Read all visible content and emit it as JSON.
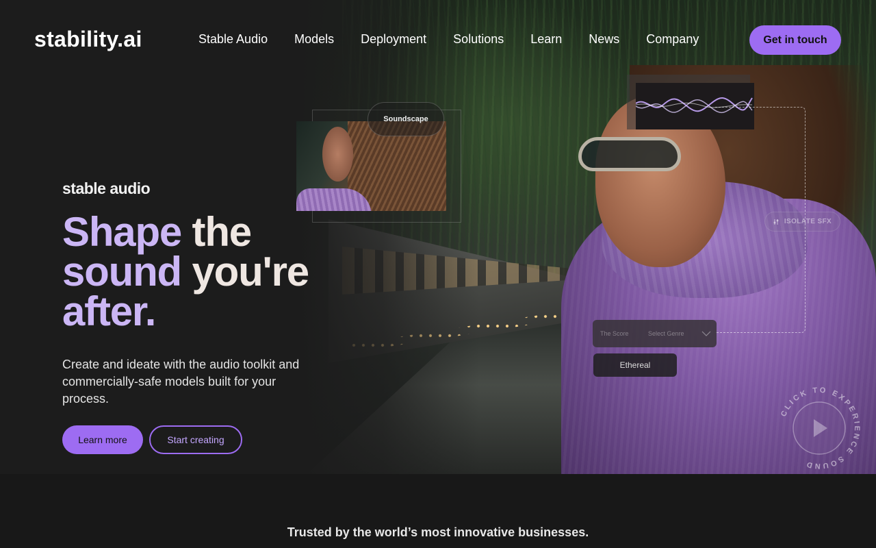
{
  "brand": {
    "logo_text": "stability.ai",
    "accent_color": "#9d6cf2"
  },
  "nav": {
    "items": [
      {
        "label": "Stable Audio"
      },
      {
        "label": "Models"
      },
      {
        "label": "Deployment"
      },
      {
        "label": "Solutions"
      },
      {
        "label": "Learn"
      },
      {
        "label": "News"
      },
      {
        "label": "Company"
      }
    ],
    "cta_label": "Get in touch"
  },
  "hero": {
    "product_label": "stable audio",
    "headline": {
      "line1_accent": "Shape",
      "line1_rest": " the",
      "line2_accent": "sound",
      "line2_rest": " you're",
      "line3_accent": "after."
    },
    "subtext": "Create and ideate with the audio toolkit and commercially-safe models built for your process.",
    "primary_button": "Learn more",
    "secondary_button": "Start creating"
  },
  "overlays": {
    "soundscape_label": "Soundscape",
    "isolate_label": "ISOLATE SFX",
    "genre_score_label": "The Score",
    "genre_select_label": "Select Genre",
    "chevron_icon": "chevron-down-icon",
    "ethereal_label": "Ethereal",
    "play_badge_text": "CLICK TO EXPERIENCE SOUND",
    "play_icon": "play-icon"
  },
  "trusted": {
    "text": "Trusted by the world’s most innovative businesses."
  }
}
